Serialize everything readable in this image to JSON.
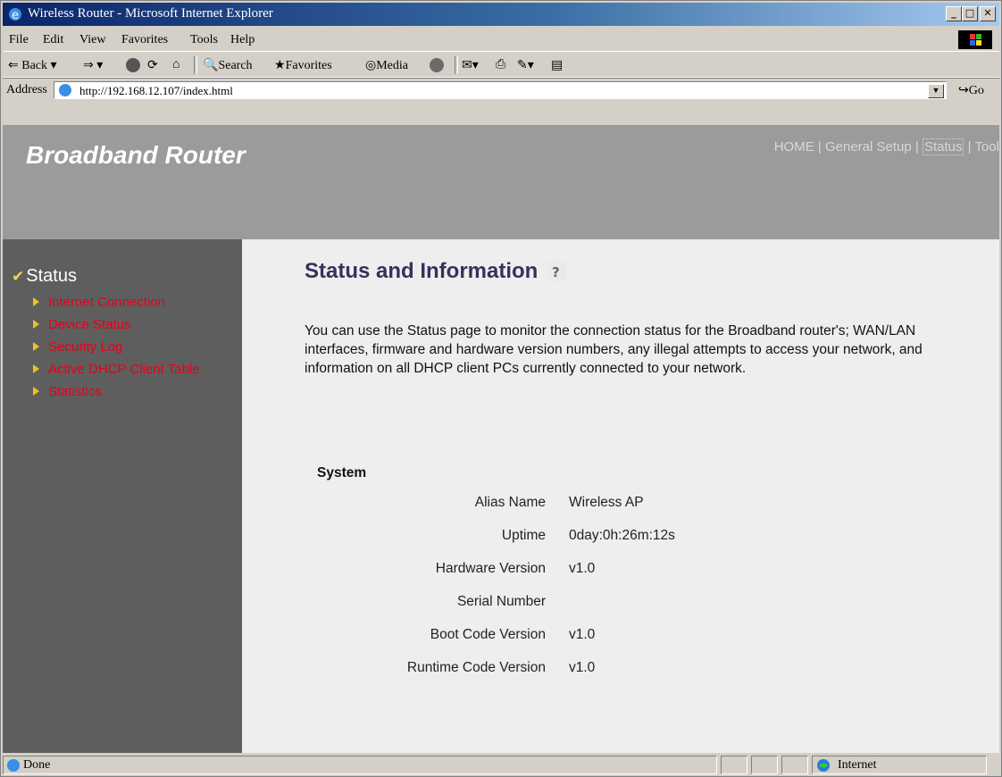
{
  "window": {
    "title": "Wireless Router - Microsoft Internet Explorer"
  },
  "menu": [
    "File",
    "Edit",
    "View",
    "Favorites",
    "Tools",
    "Help"
  ],
  "toolbar": {
    "back": "Back",
    "search": "Search",
    "favorites": "Favorites",
    "media": "Media"
  },
  "address": {
    "label": "Address",
    "url": "http://192.168.12.107/index.html",
    "go": "Go"
  },
  "banner": {
    "title": "Broadband Router"
  },
  "topnav": {
    "home": "HOME",
    "general": "General Setup",
    "status": "Status",
    "tool": "Tool",
    "sep": "|"
  },
  "sidebar": {
    "heading": "Status",
    "items": [
      {
        "label": "Internet Connection"
      },
      {
        "label": "Device Status"
      },
      {
        "label": "Security Log"
      },
      {
        "label": "Active DHCP Client Table"
      },
      {
        "label": "Statistics"
      }
    ]
  },
  "main": {
    "title": "Status and Information",
    "description": "You can use the Status page to monitor the connection status for the Broadband router's; WAN/LAN interfaces, firmware and hardware version numbers, any illegal attempts to access your network, and information on all DHCP client PCs currently connected to your network.",
    "section": "System",
    "rows": [
      {
        "key": "Alias Name",
        "value": "Wireless AP"
      },
      {
        "key": "Uptime",
        "value": "0day:0h:26m:12s"
      },
      {
        "key": "Hardware Version",
        "value": "v1.0"
      },
      {
        "key": "Serial Number",
        "value": ""
      },
      {
        "key": "Boot Code Version",
        "value": "v1.0"
      },
      {
        "key": "Runtime Code Version",
        "value": "v1.0"
      }
    ]
  },
  "statusbar": {
    "left": "Done",
    "zone": "Internet"
  },
  "colors": {
    "banner": "#9c9a9c",
    "sidebar": "#5e5e5e",
    "sidebar_link": "#e8001c",
    "title": "#33335c"
  }
}
